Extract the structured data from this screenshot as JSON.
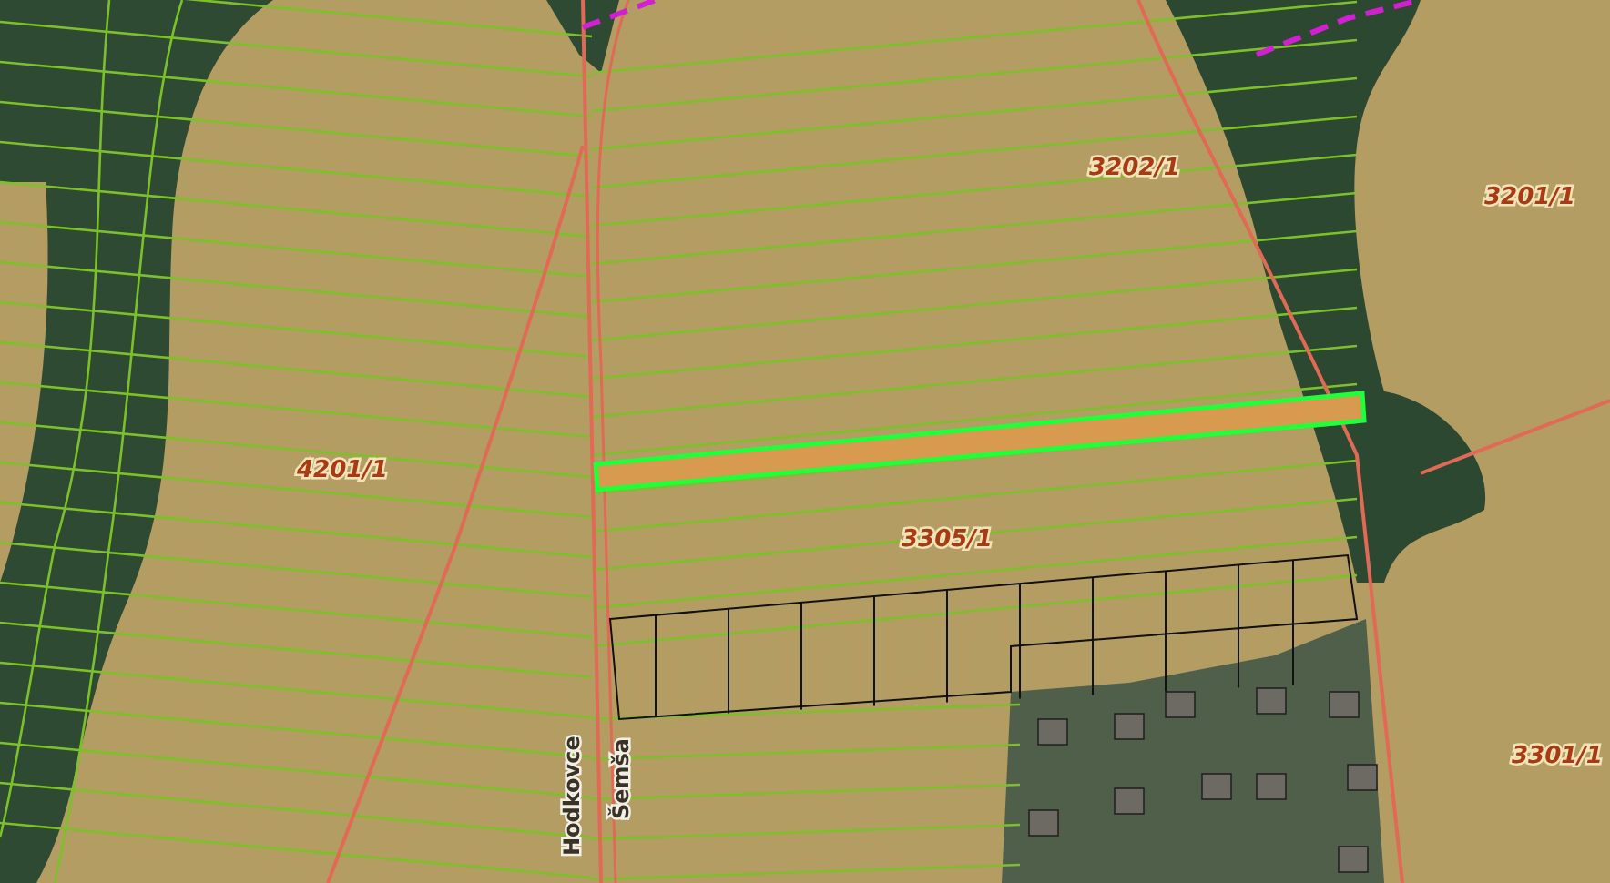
{
  "map": {
    "parcel_labels": [
      {
        "text": "4201/1"
      },
      {
        "text": "3305/1"
      },
      {
        "text": "3202/1"
      },
      {
        "text": "3201/1"
      },
      {
        "text": "3301/1"
      }
    ],
    "road_labels": [
      {
        "text": "Hodkovce"
      },
      {
        "text": "Šemša"
      }
    ],
    "highlighted_parcel": {
      "selected": true
    }
  }
}
